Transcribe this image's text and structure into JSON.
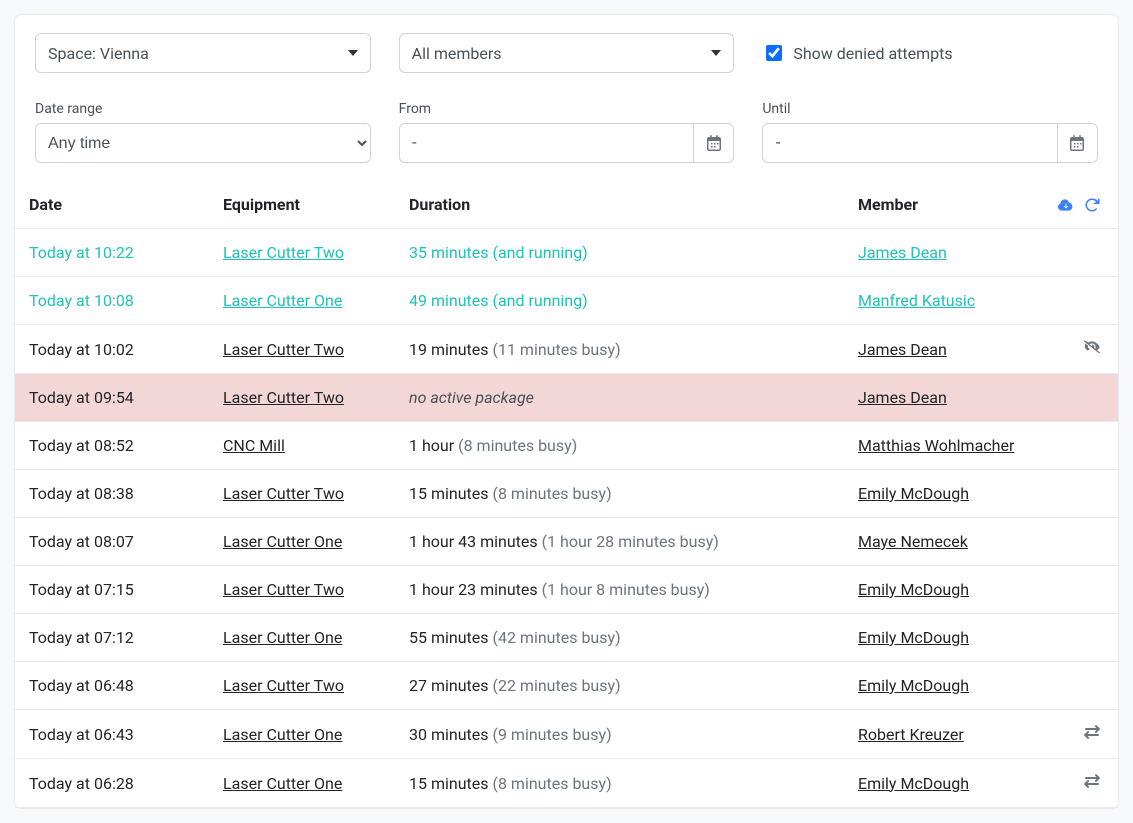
{
  "filters": {
    "space_label": "Space: Vienna",
    "members_label": "All members",
    "checkbox_label": "Show denied attempts",
    "checkbox_checked": true,
    "daterange_label": "Date range",
    "daterange_value": "Any time",
    "from_label": "From",
    "from_value": "-",
    "until_label": "Until",
    "until_value": "-"
  },
  "columns": {
    "date": "Date",
    "equipment": "Equipment",
    "duration": "Duration",
    "member": "Member"
  },
  "rows": [
    {
      "date": "Today at 10:22",
      "equipment": "Laser Cutter Two",
      "duration": "35 minutes",
      "busy": "(and running)",
      "member": "James Dean",
      "running": true,
      "icon": null
    },
    {
      "date": "Today at 10:08",
      "equipment": "Laser Cutter One",
      "duration": "49 minutes",
      "busy": "(and running)",
      "member": "Manfred Katusic",
      "running": true,
      "icon": null
    },
    {
      "date": "Today at 10:02",
      "equipment": "Laser Cutter Two",
      "duration": "19 minutes",
      "busy": "(11 minutes busy)",
      "member": "James Dean",
      "running": false,
      "icon": "eye-off"
    },
    {
      "date": "Today at 09:54",
      "equipment": "Laser Cutter Two",
      "duration": "no active package",
      "busy": "",
      "member": "James Dean",
      "running": false,
      "denied": true,
      "icon": null
    },
    {
      "date": "Today at 08:52",
      "equipment": "CNC Mill",
      "duration": "1 hour",
      "busy": "(8 minutes busy)",
      "member": "Matthias Wohlmacher",
      "running": false,
      "icon": null
    },
    {
      "date": "Today at 08:38",
      "equipment": "Laser Cutter Two",
      "duration": "15 minutes",
      "busy": "(8 minutes busy)",
      "member": "Emily McDough",
      "running": false,
      "icon": null
    },
    {
      "date": "Today at 08:07",
      "equipment": "Laser Cutter One",
      "duration": "1 hour 43 minutes",
      "busy": "(1 hour 28 minutes busy)",
      "member": "Maye Nemecek",
      "running": false,
      "icon": null
    },
    {
      "date": "Today at 07:15",
      "equipment": "Laser Cutter Two",
      "duration": "1 hour 23 minutes",
      "busy": "(1 hour 8 minutes busy)",
      "member": "Emily McDough",
      "running": false,
      "icon": null
    },
    {
      "date": "Today at 07:12",
      "equipment": "Laser Cutter One",
      "duration": "55 minutes",
      "busy": "(42 minutes busy)",
      "member": "Emily McDough",
      "running": false,
      "icon": null
    },
    {
      "date": "Today at 06:48",
      "equipment": "Laser Cutter Two",
      "duration": "27 minutes",
      "busy": "(22 minutes busy)",
      "member": "Emily McDough",
      "running": false,
      "icon": null
    },
    {
      "date": "Today at 06:43",
      "equipment": "Laser Cutter One",
      "duration": "30 minutes",
      "busy": "(9 minutes busy)",
      "member": "Robert Kreuzer",
      "running": false,
      "icon": "swap"
    },
    {
      "date": "Today at 06:28",
      "equipment": "Laser Cutter One",
      "duration": "15 minutes",
      "busy": "(8 minutes busy)",
      "member": "Emily McDough",
      "running": false,
      "icon": "swap"
    }
  ]
}
